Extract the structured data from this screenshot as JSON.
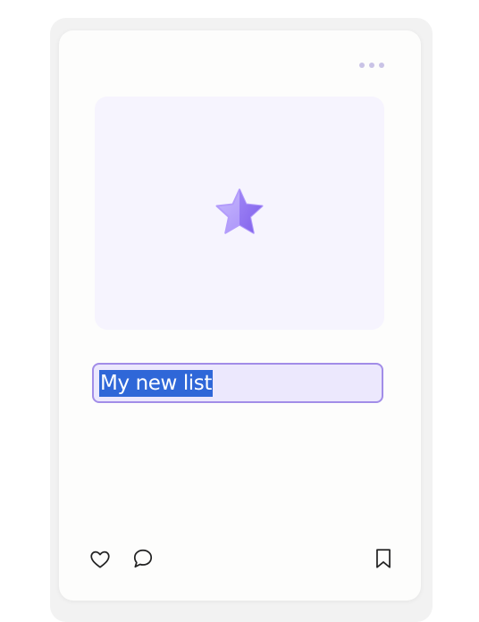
{
  "card": {
    "more_icon": "more-horizontal-icon",
    "cover_icon": "star-icon",
    "list_name_input": {
      "value": "My new list"
    },
    "actions": {
      "like_icon": "heart-icon",
      "comment_icon": "comment-icon",
      "save_icon": "bookmark-icon"
    }
  },
  "colors": {
    "accent": "#a28de8",
    "selection": "#2f67d8",
    "cover_bg": "#f6f4fe",
    "input_bg": "#ece8fd",
    "star_light": "#c4b5fd",
    "star_dark": "#8b6cf0"
  }
}
